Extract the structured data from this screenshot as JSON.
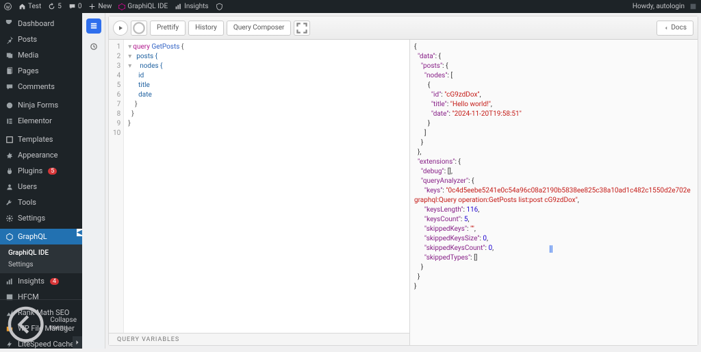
{
  "adminbar": {
    "site_name": "Test",
    "updates": "5",
    "comments": "0",
    "new": "New",
    "graphiql": "GraphiQL IDE",
    "insights": "Insights",
    "howdy": "Howdy, autologin"
  },
  "sidebar": {
    "items": [
      {
        "label": "Dashboard",
        "icon": "dashboard"
      },
      {
        "label": "Posts",
        "icon": "pin"
      },
      {
        "label": "Media",
        "icon": "media"
      },
      {
        "label": "Pages",
        "icon": "pages"
      },
      {
        "label": "Comments",
        "icon": "comments"
      },
      {
        "label": "Ninja Forms",
        "icon": "ninja"
      },
      {
        "label": "Elementor",
        "icon": "elementor"
      },
      {
        "label": "Templates",
        "icon": "templates"
      },
      {
        "label": "Appearance",
        "icon": "appearance"
      },
      {
        "label": "Plugins",
        "icon": "plugins",
        "badge": "5"
      },
      {
        "label": "Users",
        "icon": "users"
      },
      {
        "label": "Tools",
        "icon": "tools"
      },
      {
        "label": "Settings",
        "icon": "settings"
      },
      {
        "label": "GraphQL",
        "icon": "graphql",
        "current": true
      },
      {
        "label": "Insights",
        "icon": "insights",
        "badge": "4"
      },
      {
        "label": "HFCM",
        "icon": "hfcm"
      },
      {
        "label": "Rank Math SEO",
        "icon": "rankmath"
      },
      {
        "label": "WP File Manager",
        "icon": "filemanager"
      },
      {
        "label": "LiteSpeed Cache",
        "icon": "litespeed"
      }
    ],
    "sub": [
      {
        "label": "GraphiQL IDE",
        "active": true
      },
      {
        "label": "Settings"
      }
    ],
    "collapse": "Collapse menu"
  },
  "toolbar": {
    "prettify": "Prettify",
    "history": "History",
    "query_composer": "Query Composer",
    "docs": "Docs"
  },
  "query": {
    "lines": [
      "1",
      "2",
      "3",
      "4",
      "5",
      "6",
      "7",
      "8",
      "9",
      "10"
    ],
    "text_l1a": "query ",
    "text_l1b": "GetPosts",
    "text_l1c": " {",
    "text_l2": "  posts {",
    "text_l3": "    nodes {",
    "text_l4": "      id",
    "text_l5": "      title",
    "text_l6": "      date",
    "text_l7": "    }",
    "text_l8": "  }",
    "text_l9": "}"
  },
  "result": {
    "data": {
      "posts": {
        "nodes": [
          {
            "id": "cG9zdDox",
            "title": "Hello world!",
            "date": "2024-11-20T19:58:51"
          }
        ]
      }
    },
    "extensions": {
      "debug": [],
      "queryAnalyzer": {
        "keys": "0c4d5eebe5241e0c54a96c08a2190b5838ee825c38a10ad1c482c1550d2e702e graphql:Query operation:GetPosts list:post cG9zdDox",
        "keysLength": 116,
        "keysCount": 5,
        "skippedKeys": "",
        "skippedKeysSize": 0,
        "skippedKeysCount": 0,
        "skippedTypes": []
      }
    }
  },
  "footer": {
    "query_variables": "QUERY VARIABLES"
  }
}
